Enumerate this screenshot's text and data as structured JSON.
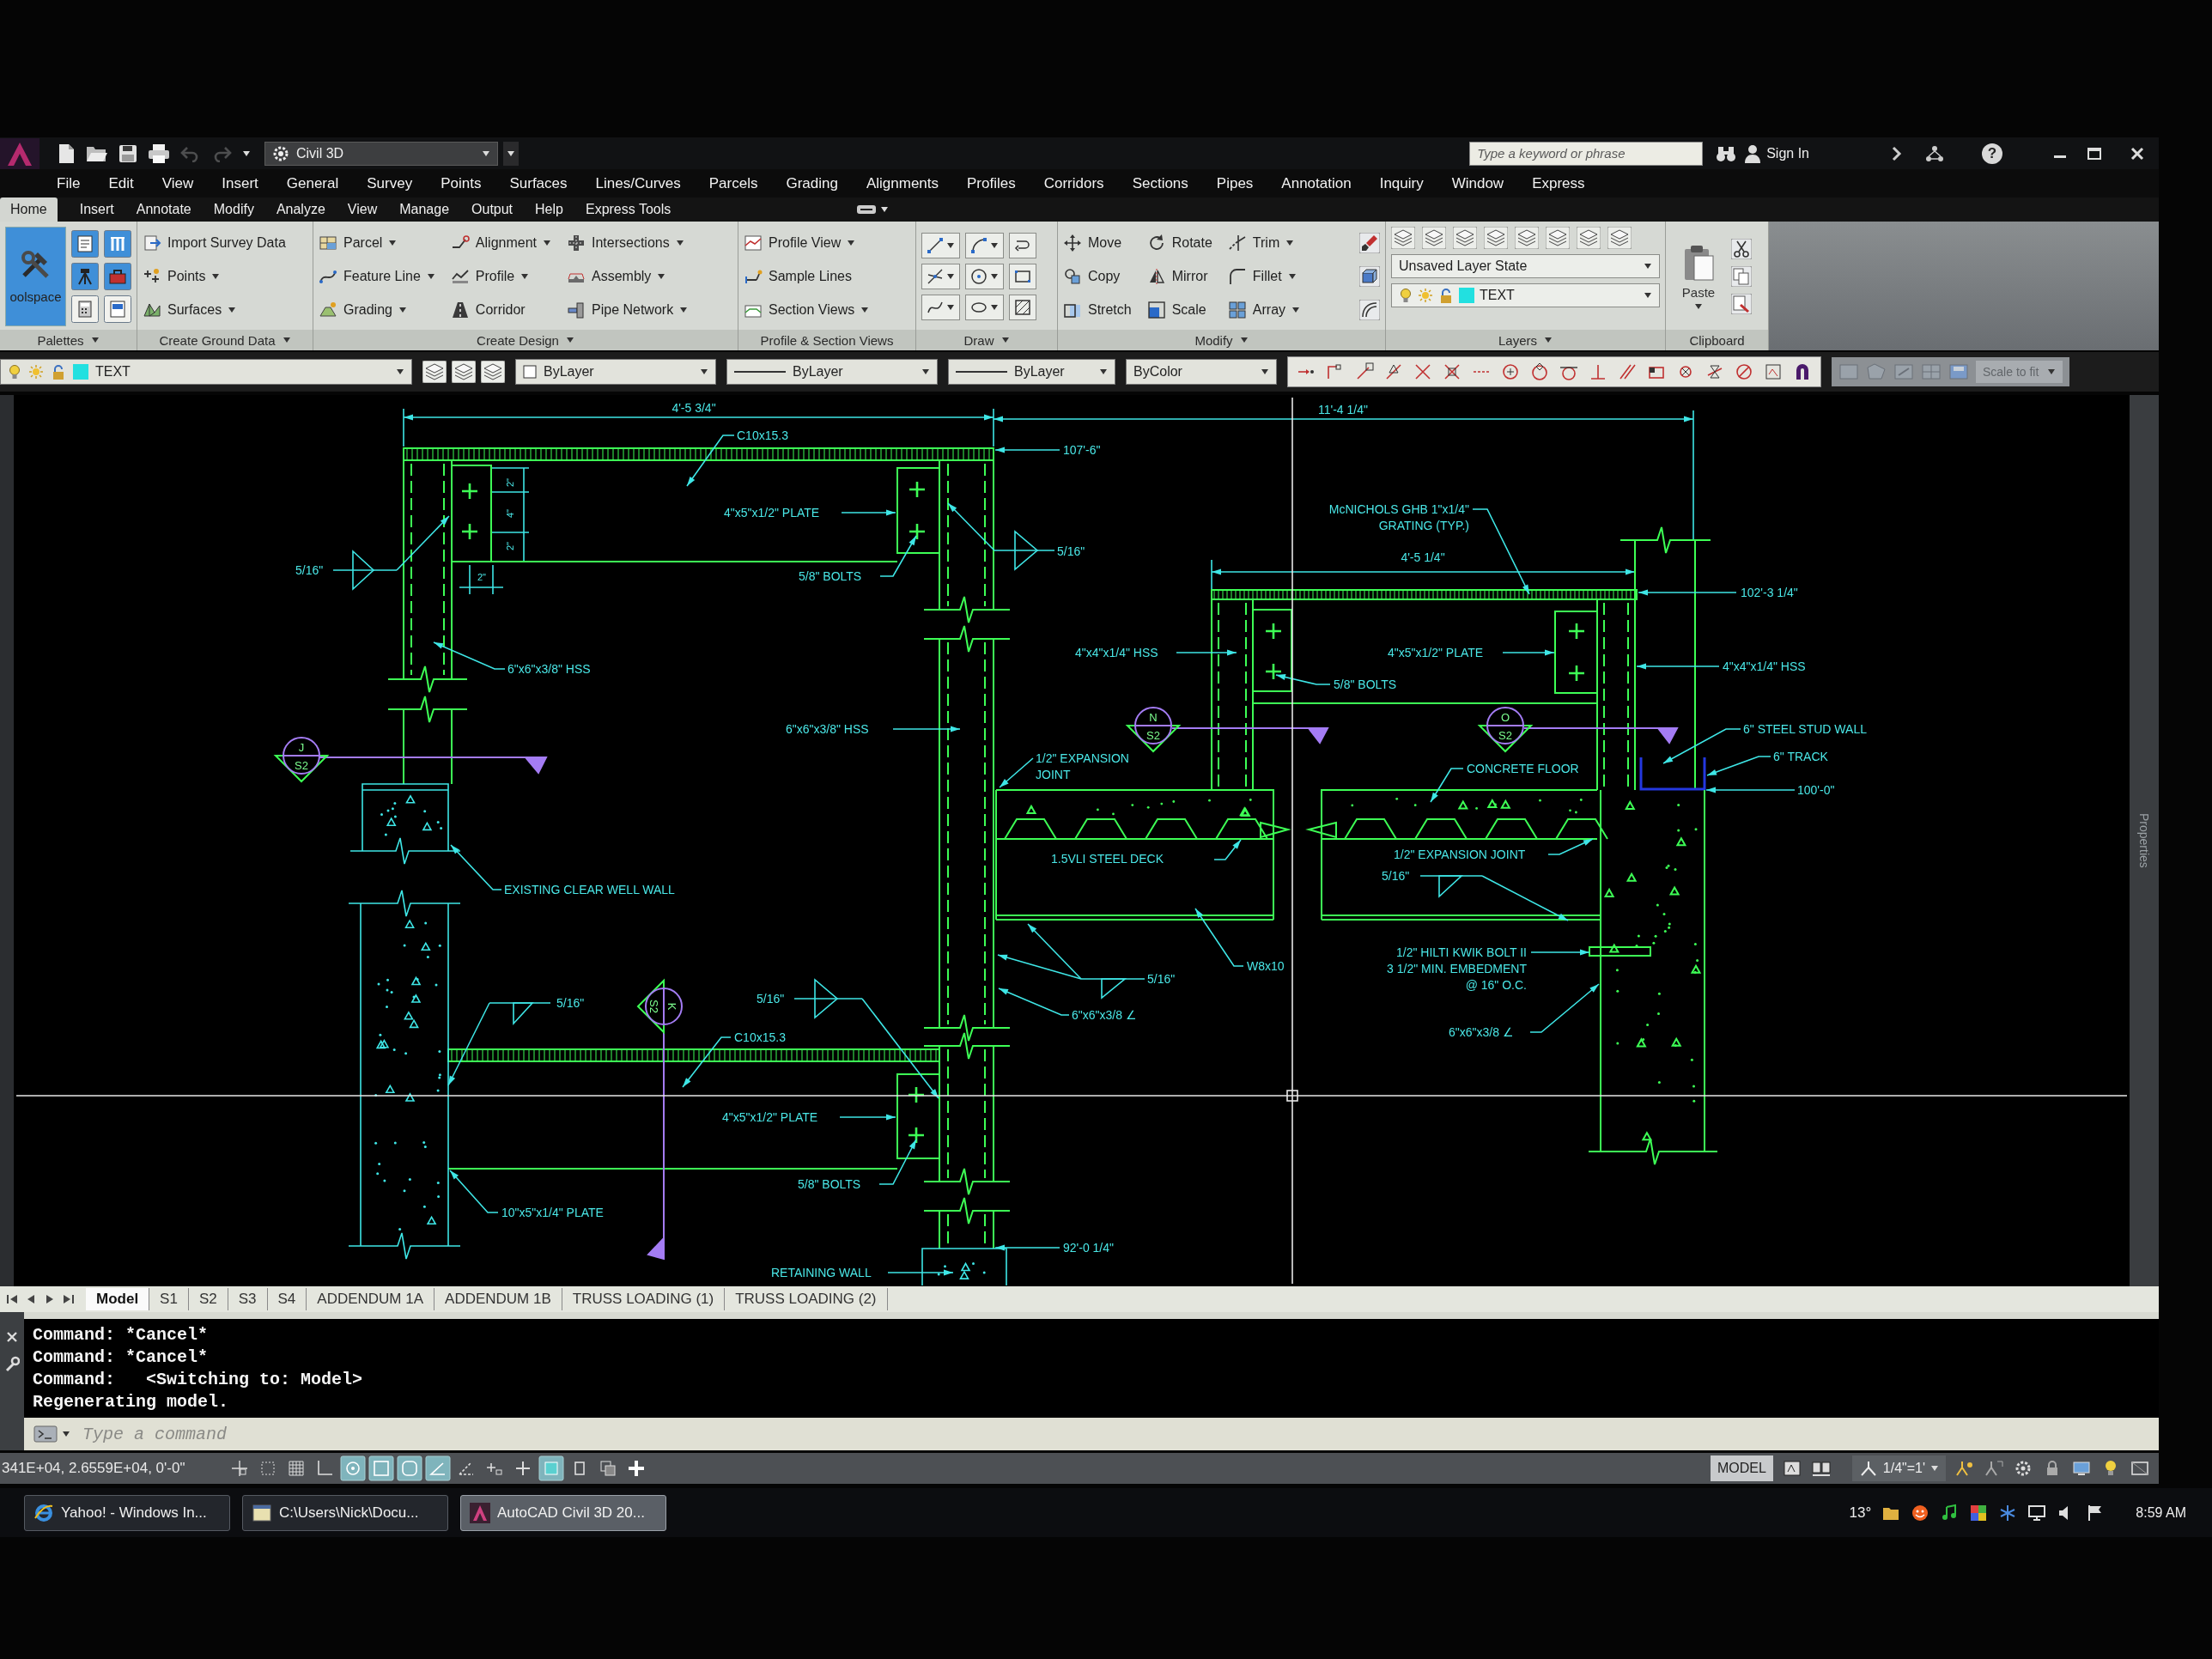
{
  "title_bar": {
    "quick_access": [
      {
        "disabled": false
      },
      {
        "disabled": false
      },
      {
        "disabled": false
      },
      {
        "disabled": false
      },
      {
        "disabled": true
      },
      {
        "disabled": true
      }
    ],
    "workspace": "Civil 3D",
    "search": {
      "placeholder": "Type a keyword or phrase"
    },
    "sign_in": "Sign In",
    "help": "?"
  },
  "menu_bar": [
    "File",
    "Edit",
    "View",
    "Insert",
    "General",
    "Survey",
    "Points",
    "Surfaces",
    "Lines/Curves",
    "Parcels",
    "Grading",
    "Alignments",
    "Profiles",
    "Corridors",
    "Sections",
    "Pipes",
    "Annotation",
    "Inquiry",
    "Window",
    "Express"
  ],
  "ribbon_tabs": [
    {
      "label": "Home",
      "selected": true
    },
    {
      "label": "Insert",
      "selected": false
    },
    {
      "label": "Annotate",
      "selected": false
    },
    {
      "label": "Modify",
      "selected": false
    },
    {
      "label": "Analyze",
      "selected": false
    },
    {
      "label": "View",
      "selected": false
    },
    {
      "label": "Manage",
      "selected": false
    },
    {
      "label": "Output",
      "selected": false
    },
    {
      "label": "Help",
      "selected": false
    },
    {
      "label": "Express Tools",
      "selected": false
    }
  ],
  "ribbon_panels": [
    {
      "kind": "palettes",
      "title": "Palettes",
      "expandable": true,
      "big_button": {
        "label": "oolspace",
        "on": true
      },
      "toggles": [
        {
          "on": true
        },
        {
          "on": true
        },
        {
          "on": true
        },
        {
          "on": true
        },
        {
          "on": false
        },
        {
          "on": false
        }
      ]
    },
    {
      "kind": "commands",
      "title": "Create Ground Data",
      "expandable": true,
      "columns": [
        [
          {
            "label": "Import Survey Data",
            "dropdown": false
          },
          {
            "label": "Points",
            "dropdown": true
          },
          {
            "label": "Surfaces",
            "dropdown": true
          }
        ]
      ]
    },
    {
      "kind": "commands",
      "title": "Create Design",
      "expandable": true,
      "columns": [
        [
          {
            "label": "Parcel",
            "dropdown": true
          },
          {
            "label": "Feature Line",
            "dropdown": true
          },
          {
            "label": "Grading",
            "dropdown": true
          }
        ],
        [
          {
            "label": "Alignment",
            "dropdown": true
          },
          {
            "label": "Profile",
            "dropdown": true
          },
          {
            "label": "Corridor",
            "dropdown": false
          }
        ],
        [
          {
            "label": "Intersections",
            "dropdown": true
          },
          {
            "label": "Assembly",
            "dropdown": true
          },
          {
            "label": "Pipe Network",
            "dropdown": true
          }
        ]
      ]
    },
    {
      "kind": "commands",
      "title": "Profile & Section Views",
      "expandable": false,
      "columns": [
        [
          {
            "label": "Profile View",
            "dropdown": true
          },
          {
            "label": "Sample Lines",
            "dropdown": false
          },
          {
            "label": "Section Views",
            "dropdown": true
          }
        ]
      ]
    },
    {
      "kind": "draw",
      "title": "Draw",
      "expandable": true,
      "tools": [
        {
          "dropdown": true
        },
        {
          "dropdown": true
        },
        {
          "dropdown": false
        },
        {
          "dropdown": true
        },
        {
          "dropdown": true
        },
        {
          "dropdown": false
        },
        {
          "dropdown": true
        },
        {
          "dropdown": true
        },
        {
          "dropdown": false
        }
      ]
    },
    {
      "kind": "commands",
      "title": "Modify",
      "expandable": true,
      "columns": [
        [
          {
            "label": "Move",
            "dropdown": false
          },
          {
            "label": "Copy",
            "dropdown": false
          },
          {
            "label": "Stretch",
            "dropdown": false
          }
        ],
        [
          {
            "label": "Rotate",
            "dropdown": false
          },
          {
            "label": "Mirror",
            "dropdown": false
          },
          {
            "label": "Scale",
            "dropdown": false
          }
        ],
        [
          {
            "label": "Trim",
            "dropdown": true
          },
          {
            "label": "Fillet",
            "dropdown": true
          },
          {
            "label": "Array",
            "dropdown": true
          }
        ]
      ]
    },
    {
      "kind": "layers",
      "title": "Layers",
      "expandable": true,
      "layer_state": "Unsaved Layer State",
      "current_layer": {
        "name": "TEXT",
        "color": "#22e0e0"
      }
    },
    {
      "kind": "clipboard",
      "title": "Clipboard",
      "expandable": false,
      "paste": {
        "label": "Paste",
        "dropdown": true
      }
    }
  ],
  "properties_bar": {
    "layer": {
      "name": "TEXT",
      "color": "#22e0e0"
    },
    "object_color": "ByLayer",
    "linetype": "ByLayer",
    "lineweight": "ByLayer",
    "plot_style": "ByColor",
    "view_scale": {
      "value": "Scale to fit",
      "disabled": true
    }
  },
  "drawing": {
    "notes": [
      {
        "text": "4'-5 3/4\""
      },
      {
        "text": "11'-4 1/4\""
      },
      {
        "text": "C10x15.3"
      },
      {
        "text": "107'-6\""
      },
      {
        "text": "2\""
      },
      {
        "text": "4\""
      },
      {
        "text": "4\"x5\"x1/2\" PLATE"
      },
      {
        "lines": [
          "McNICHOLS GHB 1\"x1/4\"",
          "GRATING (TYP.)"
        ]
      },
      {
        "text": "2\""
      },
      {
        "text": "5/16\""
      },
      {
        "text": "4'-5 1/4\""
      },
      {
        "text": "5/16\""
      },
      {
        "text": "2\""
      },
      {
        "text": "5/8\" BOLTS"
      },
      {
        "text": "102'-3 1/4\""
      },
      {
        "text": "4\"x4\"x1/4\" HSS"
      },
      {
        "text": "4\"x5\"x1/2\" PLATE"
      },
      {
        "text": "6\"x6\"x3/8\" HSS"
      },
      {
        "text": "4\"x4\"x1/4\" HSS"
      },
      {
        "text": "5/8\" BOLTS"
      },
      {
        "text": "6\"x6\"x3/8\" HSS"
      },
      {
        "text": "6\" STEEL STUD WALL"
      },
      {
        "lines": [
          "1/2\" EXPANSION",
          "JOINT"
        ]
      },
      {
        "text": "6\" TRACK"
      },
      {
        "text": "CONCRETE FLOOR"
      },
      {
        "text": "100'-0\""
      },
      {
        "text": "1.5VLI STEEL DECK"
      },
      {
        "text": "1/2\" EXPANSION JOINT"
      },
      {
        "text": "5/16\""
      },
      {
        "text": "EXISTING CLEAR WELL WALL"
      },
      {
        "text": "W8x10"
      },
      {
        "text": "5/16\""
      },
      {
        "lines": [
          "1/2\" HILTI KWIK BOLT II",
          "3 1/2\" MIN. EMBEDMENT",
          "@ 16\" O.C."
        ]
      },
      {
        "text": "5/16\""
      },
      {
        "text": "5/16\""
      },
      {
        "text": "6\"x6\"x3/8 ∠"
      },
      {
        "text": "C10x15.3"
      },
      {
        "text": "6\"x6\"x3/8 ∠"
      },
      {
        "text": "4\"x5\"x1/2\" PLATE"
      },
      {
        "text": "5/8\" BOLTS"
      },
      {
        "text": "10\"x5\"x1/4\" PLATE"
      },
      {
        "text": "92'-0 1/4\""
      },
      {
        "text": "RETAINING WALL"
      }
    ],
    "section_markers": [
      {
        "letter": "J",
        "sheet": "S2"
      },
      {
        "letter": "K",
        "sheet": "S2"
      },
      {
        "letter": "N",
        "sheet": "S2"
      },
      {
        "letter": "O",
        "sheet": "S2"
      }
    ]
  },
  "side_palette": {
    "title": "Properties"
  },
  "layout_tabs": [
    {
      "label": "Model",
      "selected": true
    },
    {
      "label": "S1",
      "selected": false
    },
    {
      "label": "S2",
      "selected": false
    },
    {
      "label": "S3",
      "selected": false
    },
    {
      "label": "S4",
      "selected": false
    },
    {
      "label": "ADDENDUM 1A",
      "selected": false
    },
    {
      "label": "ADDENDUM 1B",
      "selected": false
    },
    {
      "label": "TRUSS LOADING (1)",
      "selected": false
    },
    {
      "label": "TRUSS LOADING (2)",
      "selected": false
    }
  ],
  "command_line": {
    "history": [
      "Command: *Cancel*",
      "Command: *Cancel*",
      "Command:   <Switching to: Model>",
      "Regenerating model."
    ],
    "input": {
      "placeholder": "Type a command"
    }
  },
  "status_bar": {
    "coordinates": "341E+04, 2.6559E+04, 0'-0\"",
    "toggles": [
      {
        "on": false
      },
      {
        "on": false
      },
      {
        "on": false
      },
      {
        "on": false
      },
      {
        "on": true
      },
      {
        "on": true
      },
      {
        "on": true
      },
      {
        "on": true
      },
      {
        "on": false
      },
      {
        "on": false
      },
      {
        "on": false
      },
      {
        "on": true
      },
      {
        "on": false
      },
      {
        "on": false
      },
      {
        "on": false
      }
    ],
    "space": "MODEL",
    "annotation_scale": "1/4\"=1'"
  },
  "taskbar": {
    "buttons": [
      {
        "label": "Yahoo! - Windows In...",
        "selected": false
      },
      {
        "label": "C:\\Users\\Nick\\Docu...",
        "selected": false
      },
      {
        "label": "AutoCAD Civil 3D 20...",
        "selected": true
      }
    ],
    "tray": {
      "temperature": "13°",
      "clock": "8:59 AM"
    }
  }
}
